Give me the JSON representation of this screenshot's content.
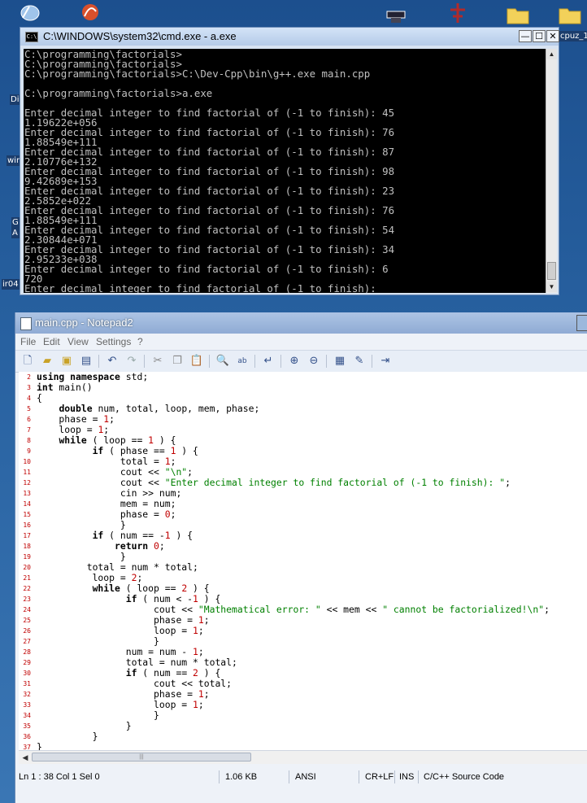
{
  "desktop": {
    "icons": [
      {
        "name": "desktop-shortcut-1-icon"
      },
      {
        "name": "desktop-shortcut-2-icon"
      },
      {
        "name": "desktop-shortcut-3-icon"
      },
      {
        "name": "desktop-shortcut-4-icon"
      },
      {
        "name": "folder-icon"
      },
      {
        "name": "folder-icon"
      }
    ],
    "labels": [
      "cpuz_1",
      "Di",
      "wir",
      "G",
      "A",
      "ir04"
    ]
  },
  "cmd": {
    "title": "C:\\WINDOWS\\system32\\cmd.exe - a.exe",
    "icon_text": "C:\\",
    "buttons": {
      "minimize": "—",
      "maximize": "☐",
      "close": "✕"
    },
    "lines": [
      "C:\\programming\\factorials>",
      "C:\\programming\\factorials>",
      "C:\\programming\\factorials>C:\\Dev-Cpp\\bin\\g++.exe main.cpp",
      "",
      "C:\\programming\\factorials>a.exe",
      "",
      "Enter decimal integer to find factorial of (-1 to finish): 45",
      "1.19622e+056",
      "Enter decimal integer to find factorial of (-1 to finish): 76",
      "1.88549e+111",
      "Enter decimal integer to find factorial of (-1 to finish): 87",
      "2.10776e+132",
      "Enter decimal integer to find factorial of (-1 to finish): 98",
      "9.42689e+153",
      "Enter decimal integer to find factorial of (-1 to finish): 23",
      "2.5852e+022",
      "Enter decimal integer to find factorial of (-1 to finish): 76",
      "1.88549e+111",
      "Enter decimal integer to find factorial of (-1 to finish): 54",
      "2.30844e+071",
      "Enter decimal integer to find factorial of (-1 to finish): 34",
      "2.95233e+038",
      "Enter decimal integer to find factorial of (-1 to finish): 6",
      "720",
      "Enter decimal integer to find factorial of (-1 to finish): "
    ]
  },
  "notepad": {
    "title": "main.cpp - Notepad2",
    "menu": [
      "File",
      "Edit",
      "View",
      "Settings",
      "?"
    ],
    "toolbar": [
      "new-file-icon",
      "open-file-icon",
      "browse-icon",
      "save-icon",
      "undo-icon",
      "redo-icon",
      "cut-icon",
      "copy-icon",
      "paste-icon",
      "find-icon",
      "replace-icon",
      "word-wrap-icon",
      "zoom-in-icon",
      "zoom-out-icon",
      "scheme-icon",
      "customize-icon",
      "exit-icon"
    ],
    "code": [
      {
        "n": "2",
        "t": "using namespace std;"
      },
      {
        "n": "3",
        "t": "int main()"
      },
      {
        "n": "4",
        "t": "{"
      },
      {
        "n": "5",
        "t": "    double num, total, loop, mem, phase;"
      },
      {
        "n": "6",
        "t": "    phase = 1;"
      },
      {
        "n": "7",
        "t": "    loop = 1;"
      },
      {
        "n": "8",
        "t": "    while ( loop == 1 ) {"
      },
      {
        "n": "9",
        "t": "          if ( phase == 1 ) {"
      },
      {
        "n": "10",
        "t": "               total = 1;"
      },
      {
        "n": "11",
        "t": "               cout << \"\\n\";"
      },
      {
        "n": "12",
        "t": "               cout << \"Enter decimal integer to find factorial of (-1 to finish): \";"
      },
      {
        "n": "13",
        "t": "               cin >> num;"
      },
      {
        "n": "14",
        "t": "               mem = num;"
      },
      {
        "n": "15",
        "t": "               phase = 0;"
      },
      {
        "n": "16",
        "t": "               }"
      },
      {
        "n": "17",
        "t": "          if ( num == -1 ) {"
      },
      {
        "n": "18",
        "t": "              return 0;"
      },
      {
        "n": "19",
        "t": "               }"
      },
      {
        "n": "20",
        "t": "         total = num * total;"
      },
      {
        "n": "21",
        "t": "          loop = 2;"
      },
      {
        "n": "22",
        "t": "          while ( loop == 2 ) {"
      },
      {
        "n": "23",
        "t": "                if ( num < -1 ) {"
      },
      {
        "n": "24",
        "t": "                     cout << \"Mathematical error: \" << mem << \" cannot be factorialized!\\n\";"
      },
      {
        "n": "25",
        "t": "                     phase = 1;"
      },
      {
        "n": "26",
        "t": "                     loop = 1;"
      },
      {
        "n": "27",
        "t": "                     }"
      },
      {
        "n": "28",
        "t": "                num = num - 1;"
      },
      {
        "n": "29",
        "t": "                total = num * total;"
      },
      {
        "n": "30",
        "t": "                if ( num == 2 ) {"
      },
      {
        "n": "31",
        "t": "                     cout << total;"
      },
      {
        "n": "32",
        "t": "                     phase = 1;"
      },
      {
        "n": "33",
        "t": "                     loop = 1;"
      },
      {
        "n": "34",
        "t": "                     }"
      },
      {
        "n": "35",
        "t": "                }"
      },
      {
        "n": "36",
        "t": "          }"
      },
      {
        "n": "37",
        "t": "}"
      }
    ],
    "status": {
      "position": "Ln 1 : 38   Col 1   Sel 0",
      "size": "1.06 KB",
      "encoding": "ANSI",
      "eol": "CR+LF",
      "mode": "INS",
      "scheme": "C/C++ Source Code"
    }
  }
}
